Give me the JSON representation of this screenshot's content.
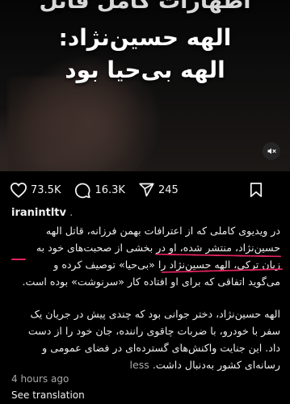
{
  "video": {
    "title_line1": "اظهارات کامل قاتل",
    "title_line2": "الهه حسین‌نژاد:",
    "title_line3": "الهه بی‌حیا بود",
    "mute_icon": "speaker-muted-icon"
  },
  "actions": {
    "likes": "73.5K",
    "comments": "16.3K",
    "shares": "245"
  },
  "post": {
    "username": "iranintltv",
    "username_suffix": " .",
    "caption_p1": [
      "در ویدیوی کاملی که از اعترافات بهمن فرزانه، قاتل الهه",
      "حسین‌نژاد، منتشر شده، او در بخشی از صحبت‌های خود به",
      "زبان ترکی، الهه حسین‌نژاد را «بی‌حیا» توصیف کرده و",
      "می‌گوید اتفاقی که برای او افتاده کار «سرنوشت» بوده است."
    ],
    "caption_p2": [
      "الهه حسین‌نژاد، دختر جوانی بود که چندی پیش در جریان یک",
      "سفر با خودرو، با ضربات چاقوی راننده، جان خود را از دست",
      "داد. این جنایت واکنش‌های گسترده‌ای در فضای عمومی و",
      "رسانه‌ای کشور به‌دنبال داشت."
    ],
    "less_label": "less",
    "timestamp": "4 hours ago",
    "translate_label": "See translation"
  },
  "colors": {
    "background": "#000000",
    "annotation_underline": "#e0245e",
    "muted_text": "#a8a8a8"
  }
}
